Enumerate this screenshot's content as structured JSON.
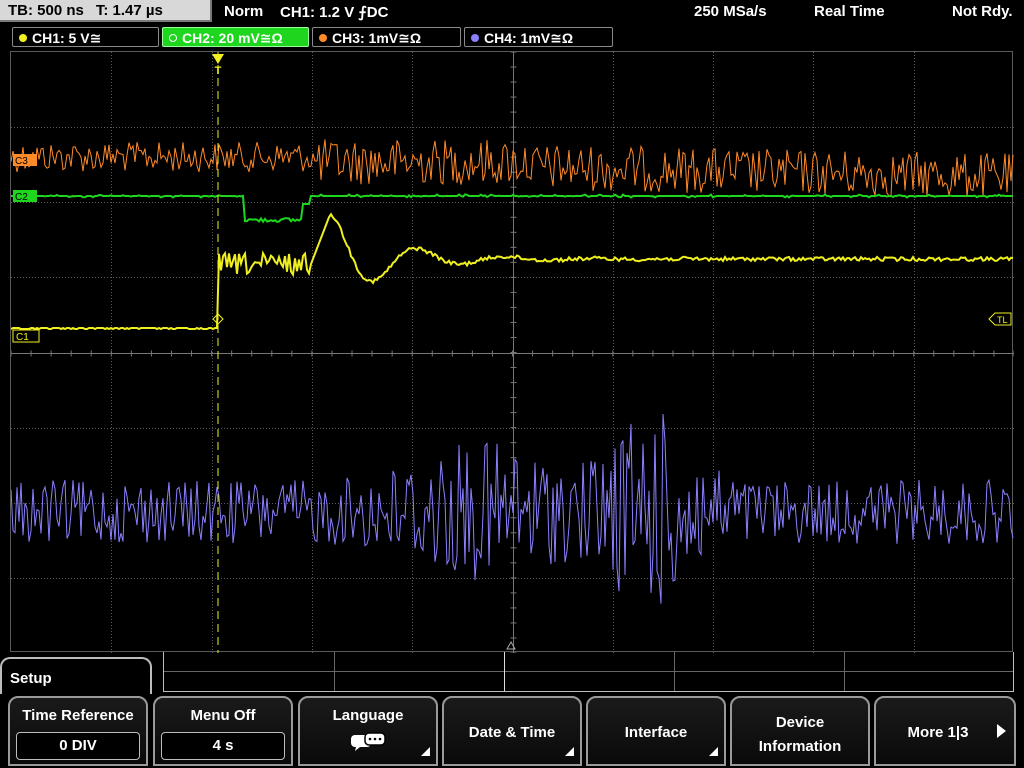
{
  "status": {
    "timebase": "TB: 500 ns",
    "trigger_time": "T: 1.47 µs",
    "trigger_mode": "Norm",
    "trigger_info": "CH1: 1.2 V ⨍DC",
    "sample_rate": "250 MSa/s",
    "acq_mode": "Real Time",
    "state": "Not Rdy."
  },
  "channels": [
    {
      "label": "CH1: 5 V≅",
      "color": "#f0f020"
    },
    {
      "label": "CH2: 20 mV≅Ω",
      "color": "#1ed61e"
    },
    {
      "label": "CH3: 1mV≅Ω",
      "color": "#ff8a2a"
    },
    {
      "label": "CH4: 1mV≅Ω",
      "color": "#8a80ff"
    }
  ],
  "markers": {
    "c1": "C1",
    "c2": "C2",
    "c3": "C3",
    "trigger_level": "TL",
    "trigger_pos": "T"
  },
  "menu": {
    "title": "Setup",
    "softkeys": [
      {
        "label": "Time Reference",
        "value": "0 DIV"
      },
      {
        "label": "Menu Off",
        "value": "4 s"
      },
      {
        "label": "Language",
        "icon": "speech-bubbles-icon"
      },
      {
        "label": "Date & Time"
      },
      {
        "label": "Interface"
      },
      {
        "label1": "Device",
        "label2": "Information"
      },
      {
        "label": "More 1|3"
      }
    ]
  },
  "colors": {
    "ch1": "#f0f020",
    "ch2": "#1ed61e",
    "ch3": "#ff8a2a",
    "ch4": "#8a80ff",
    "grid": "#5a5a5a",
    "trigger_marker": "#f0f020"
  }
}
